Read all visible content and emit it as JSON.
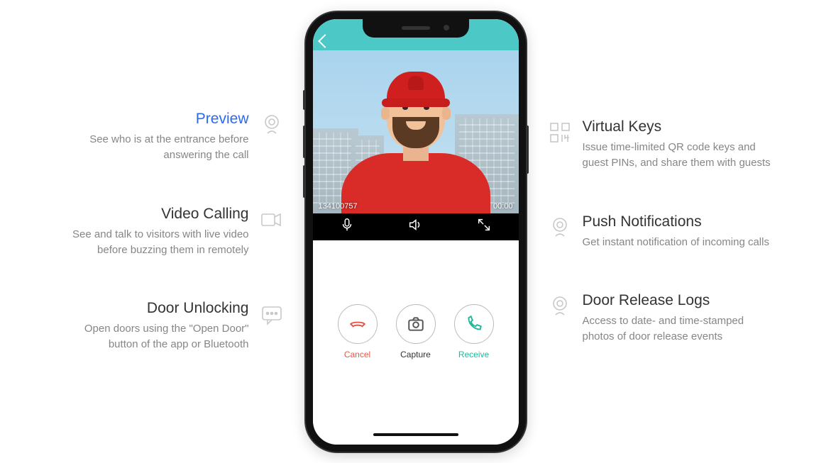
{
  "left_features": [
    {
      "title": "Preview",
      "desc": "See who is at the entrance before answering the call",
      "icon": "camera"
    },
    {
      "title": "Video Calling",
      "desc": "See and talk to visitors with live video before buzzing them in remotely",
      "icon": "video"
    },
    {
      "title": "Door Unlocking",
      "desc": "Open doors using the \"Open Door\" button of the app or Bluetooth",
      "icon": "chat"
    }
  ],
  "right_features": [
    {
      "title": "Virtual Keys",
      "desc": "Issue time-limited QR code keys and guest PINs, and share them with guests",
      "icon": "qr"
    },
    {
      "title": "Push Notifications",
      "desc": "Get instant notification of incoming calls",
      "icon": "camera"
    },
    {
      "title": "Door Release Logs",
      "desc": "Access to date- and time-stamped photos of door release events",
      "icon": "camera"
    }
  ],
  "phone": {
    "caller_id": "134100757",
    "timer": "00:00",
    "cancel": "Cancel",
    "capture": "Capture",
    "receive": "Receive"
  }
}
